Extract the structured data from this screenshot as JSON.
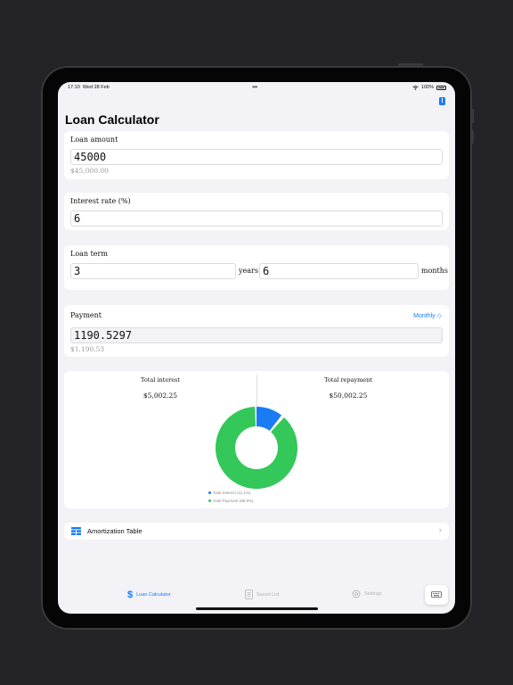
{
  "status_bar": {
    "time": "17:10",
    "date": "Wed 28 Feb",
    "battery": "100%"
  },
  "title": "Loan Calculator",
  "loan_amount": {
    "label": "Loan amount",
    "value": "45000",
    "formatted": "$45,000.00"
  },
  "interest_rate": {
    "label": "Interest rate (%)",
    "value": "6"
  },
  "loan_term": {
    "label": "Loan term",
    "years_value": "3",
    "years_unit": "years",
    "months_value": "6",
    "months_unit": "months"
  },
  "payment": {
    "label": "Payment",
    "frequency": "Monthly ◇",
    "value": "1190.5297",
    "formatted": "$1,190.53"
  },
  "summary": {
    "total_interest_label": "Total interest",
    "total_interest_value": "$5,002.25",
    "total_repayment_label": "Total repayment",
    "total_repayment_value": "$50,002.25",
    "legend": [
      {
        "label": "Total Interest (11.1%)",
        "color": "#1a7cf5"
      },
      {
        "label": "Total Payment (88.9%)",
        "color": "#34c759"
      }
    ]
  },
  "donut": {
    "interest_fraction": 0.111,
    "payment_fraction": 0.889
  },
  "amortization": {
    "label": "Amortization Table",
    "chevron": "›"
  },
  "tabs": [
    {
      "label": "Loan Calculator",
      "icon": "dollar-icon",
      "active": true
    },
    {
      "label": "Saved List",
      "icon": "list-icon",
      "active": false
    },
    {
      "label": "Settings",
      "icon": "gear-icon",
      "active": false
    }
  ],
  "colors": {
    "accent": "#1a7cf5",
    "green": "#34c759",
    "background": "#f2f2f7"
  }
}
